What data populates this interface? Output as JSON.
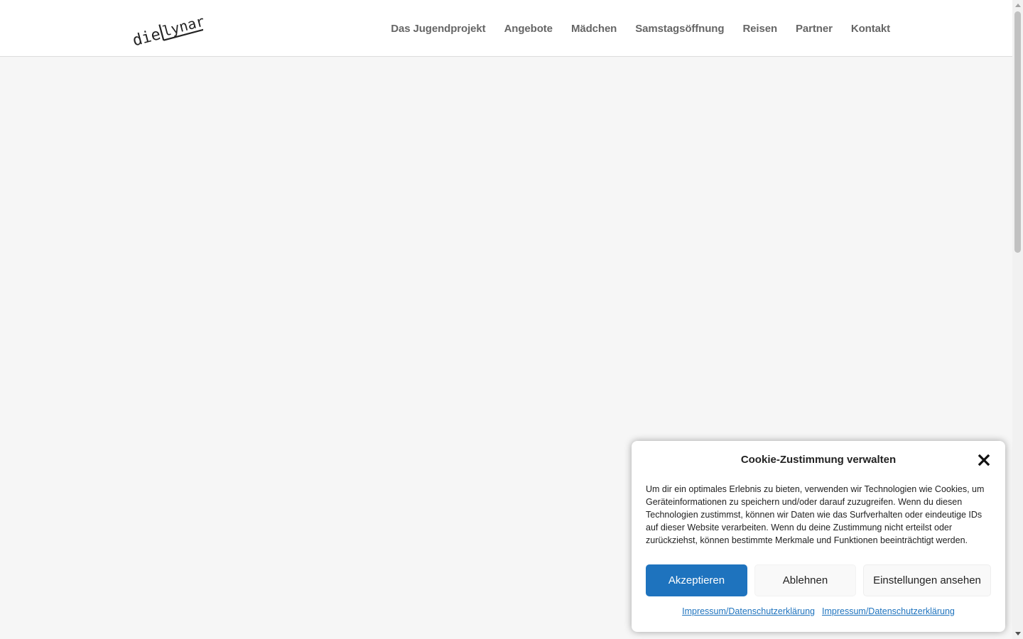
{
  "header": {
    "logo": {
      "text_left": "die",
      "text_right": "lynar",
      "color": "#222222"
    },
    "nav": [
      {
        "label": "Das Jugendprojekt"
      },
      {
        "label": "Angebote"
      },
      {
        "label": "Mädchen"
      },
      {
        "label": "Samstagsöffnung"
      },
      {
        "label": "Reisen"
      },
      {
        "label": "Partner"
      },
      {
        "label": "Kontakt"
      }
    ]
  },
  "cookie_banner": {
    "title": "Cookie-Zustimmung verwalten",
    "close_icon": "close-icon",
    "text": "Um dir ein optimales Erlebnis zu bieten, verwenden wir Technologien wie Cookies, um Geräteinformationen zu speichern und/oder darauf zuzugreifen. Wenn du diesen Technologien zustimmst, können wir Daten wie das Surfverhalten oder eindeutige IDs auf dieser Website verarbeiten. Wenn du deine Zustimmung nicht erteilst oder zurückziehst, können bestimmte Merkmale und Funktionen beeinträchtigt werden.",
    "accept_label": "Akzeptieren",
    "deny_label": "Ablehnen",
    "settings_label": "Einstellungen ansehen",
    "links": [
      {
        "label": "Impressum/Datenschutzerklärung"
      },
      {
        "label": "Impressum/Datenschutzerklärung"
      }
    ],
    "accent_color": "#1e73be"
  }
}
